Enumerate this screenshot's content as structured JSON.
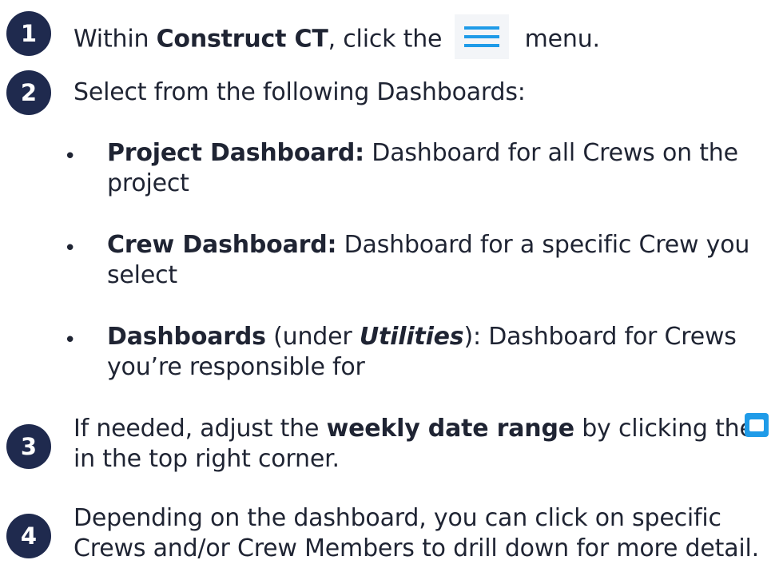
{
  "steps": [
    {
      "number": "1",
      "pre": "Within ",
      "bold": "Construct CT",
      "mid": ", click the ",
      "post": "menu.",
      "icon": "hamburger-menu-icon"
    },
    {
      "number": "2",
      "text": "Select from the following Dashboards:"
    },
    {
      "number": "3",
      "pre": "If needed, adjust the ",
      "bold": "weekly date range",
      "mid": " by clicking the",
      "line2": "in the top right corner.",
      "icon": "calendar-icon"
    },
    {
      "number": "4",
      "line1": "Depending on the dashboard, you can click on specific",
      "line2": "Crews and/or Crew Members to drill down for more detail."
    }
  ],
  "dashboards": [
    {
      "bullet": "•",
      "bold": "Project Dashboard:",
      "rest": " Dashboard for all Crews on the",
      "line2": "project"
    },
    {
      "bullet": "•",
      "bold": "Crew Dashboard:",
      "rest": " Dashboard for a specific Crew you",
      "line2": "select"
    },
    {
      "bullet": "•",
      "bold": "Dashboards",
      "rest_a": " (under ",
      "italic": "Utilities",
      "rest_b": "): Dashboard for Crews",
      "line2": "you’re responsible for"
    }
  ],
  "colors": {
    "badge": "#1f2a4e",
    "menu_icon": "#1f9be8",
    "calendar_icon": "#1f9be8",
    "text": "#1f2433"
  }
}
